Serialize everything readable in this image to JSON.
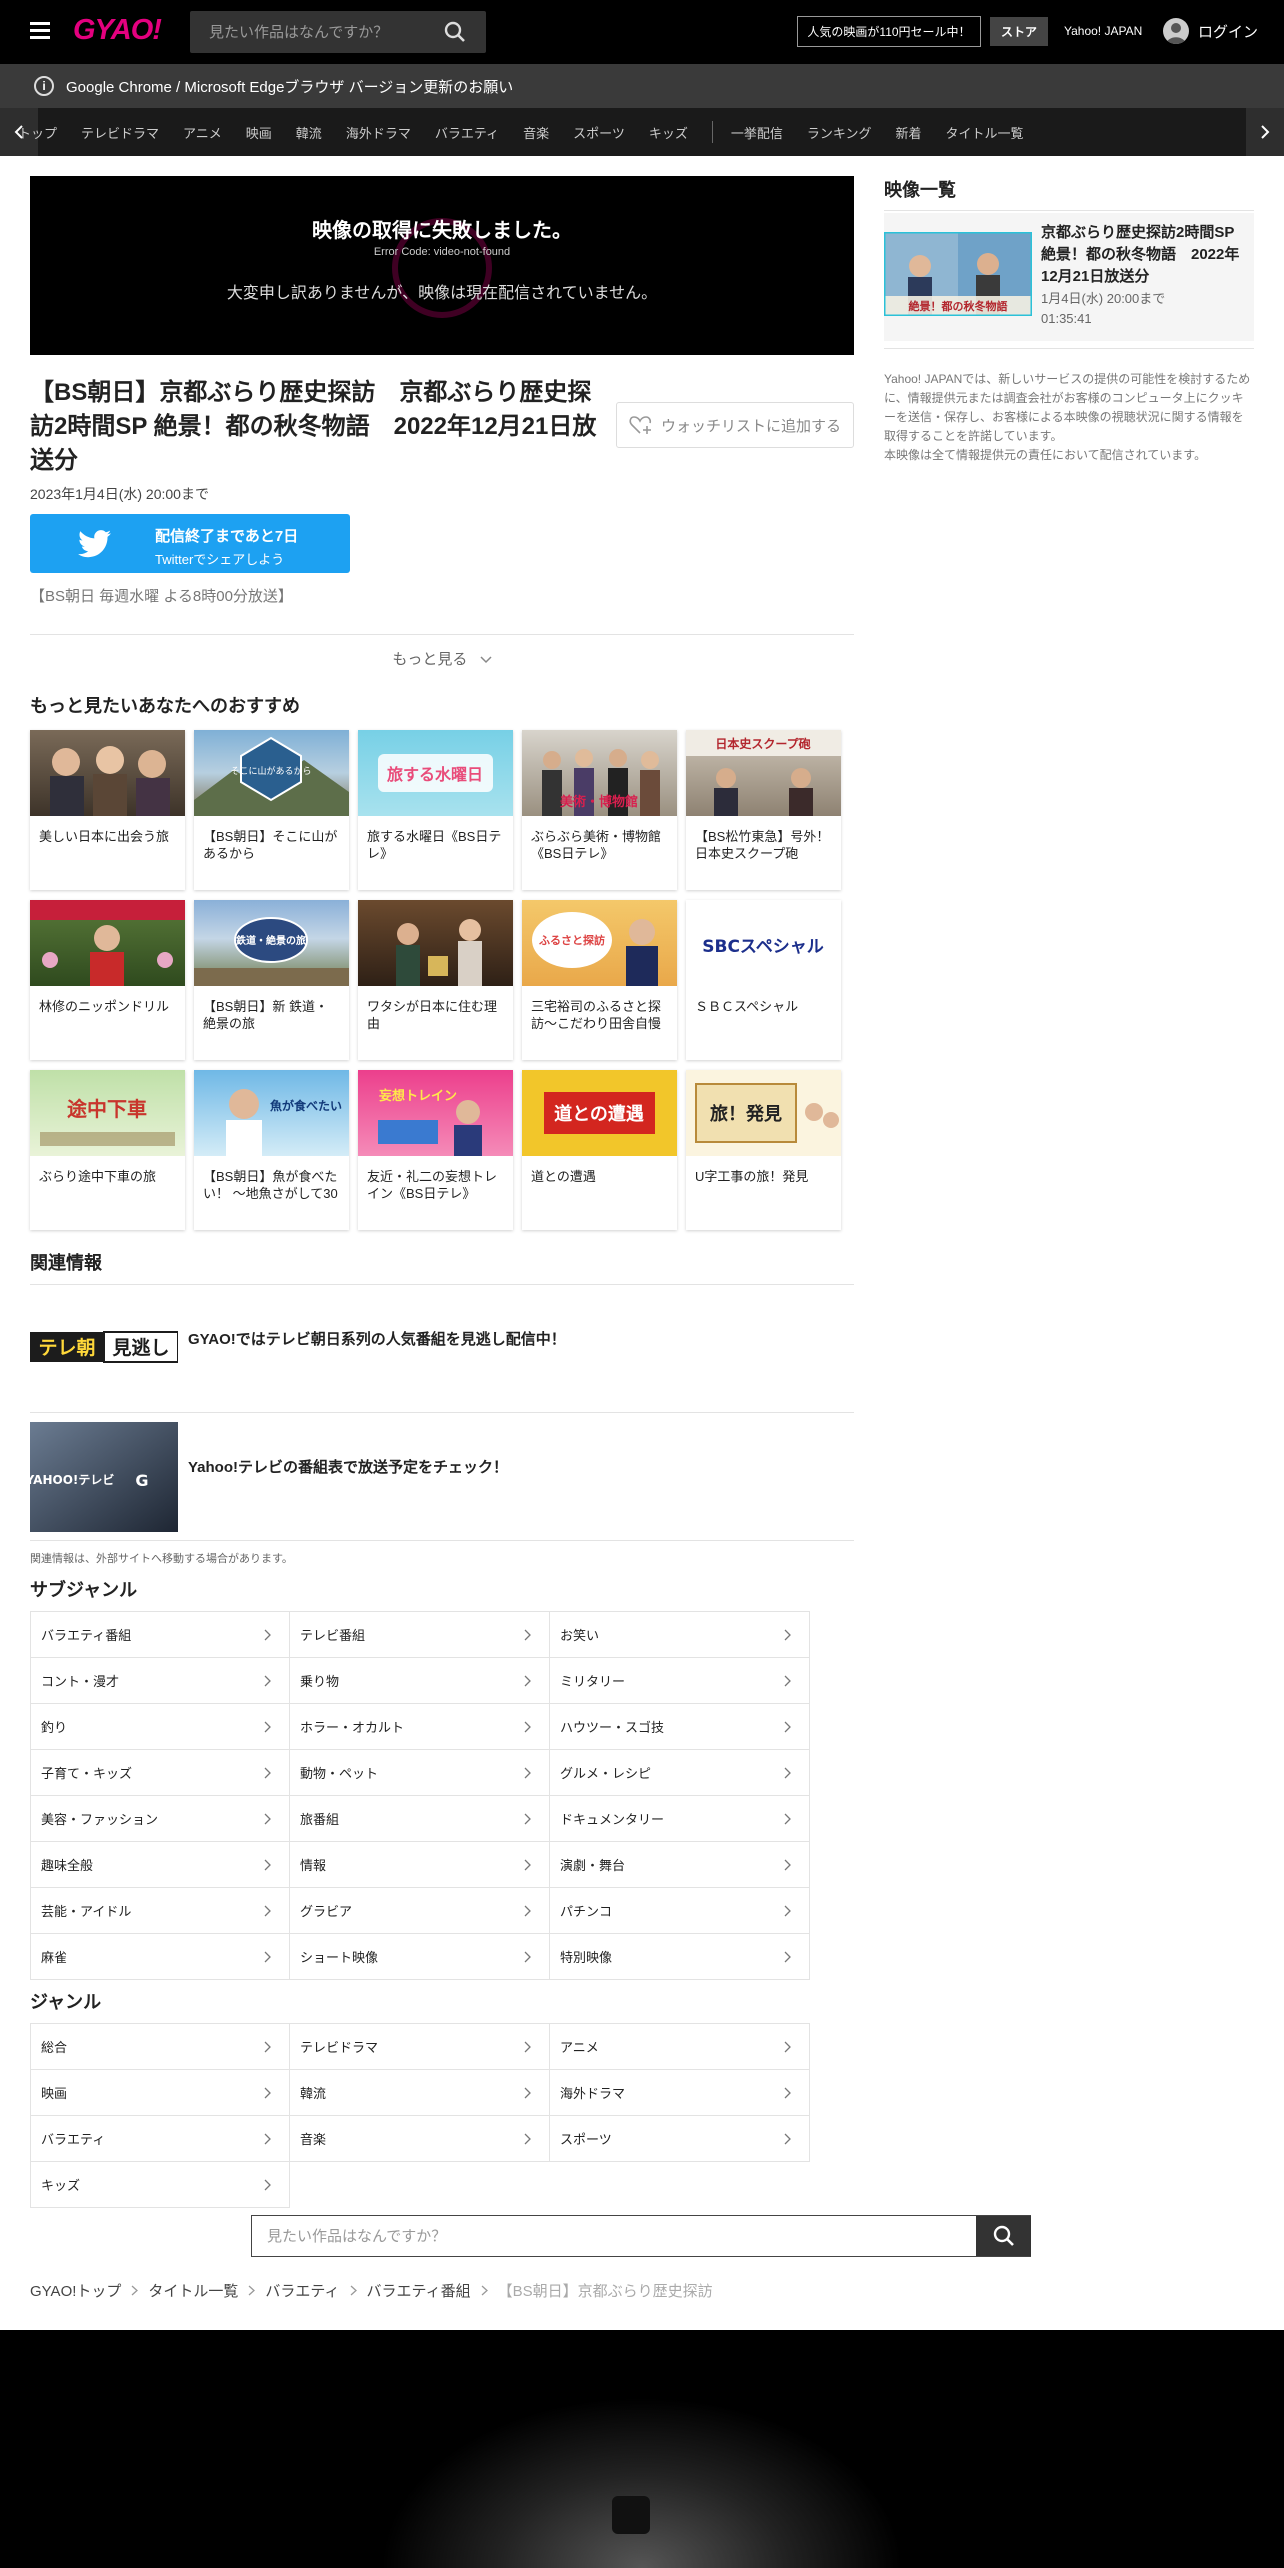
{
  "header": {
    "logo": "GYAO!",
    "search_placeholder": "見たい作品はなんですか？",
    "sale_label": "人気の映画が110円セール中！",
    "store_label": "ストア",
    "yahoo_label": "Yahoo! JAPAN",
    "login_label": "ログイン"
  },
  "banner": {
    "text": "Google Chrome / Microsoft Edgeブラウザ バージョン更新のお願い"
  },
  "nav": {
    "items": [
      "トップ",
      "テレビドラマ",
      "アニメ",
      "映画",
      "韓流",
      "海外ドラマ",
      "バラエティ",
      "音楽",
      "スポーツ",
      "キッズ"
    ],
    "items2": [
      "一挙配信",
      "ランキング",
      "新着",
      "タイトル一覧"
    ]
  },
  "player": {
    "error_title": "映像の取得に失敗しました。",
    "error_code": "Error Code: video-not-found",
    "error_message": "大変申し訳ありませんが、映像は現在配信されていません。"
  },
  "episode": {
    "title": "【BS朝日】京都ぶらり歴史探訪　京都ぶらり歴史探訪2時間SP 絶景！都の秋冬物語　2022年12月21日放送分",
    "watchlist_label": "ウォッチリストに追加する",
    "available_until": "2023年1月4日(水) 20:00まで",
    "twitter_line1": "配信終了まであと7日",
    "twitter_line2": "Twitterでシェアしよう",
    "broadcast_note": "【BS朝日 毎週水曜 よる8時00分放送】",
    "more_label": "もっと見る"
  },
  "recommend": {
    "heading": "もっと見たいあなたへのおすすめ",
    "items": [
      {
        "title": "美しい日本に出会う旅"
      },
      {
        "title": "【BS朝日】そこに山があるから"
      },
      {
        "title": "旅する水曜日《BS日テレ》"
      },
      {
        "title": "ぶらぶら美術・博物館《BS日テレ》"
      },
      {
        "title": "【BS松竹東急】号外！日本史スクープ砲"
      },
      {
        "title": "林修のニッポンドリル"
      },
      {
        "title": "【BS朝日】新 鉄道・絶景の旅"
      },
      {
        "title": "ワタシが日本に住む理由"
      },
      {
        "title": "三宅裕司のふるさと探訪～こだわり田舎自慢"
      },
      {
        "title": "ＳＢＣスペシャル"
      },
      {
        "title": "ぶらり途中下車の旅"
      },
      {
        "title": "【BS朝日】魚が食べたい！ ～地魚さがして30"
      },
      {
        "title": "友近・礼二の妄想トレイン《BS日テレ》"
      },
      {
        "title": "道との遭遇"
      },
      {
        "title": "U字工事の旅！発見"
      }
    ],
    "thumb_texts": {
      "t2": "そこに山があるから",
      "t3": "旅する水曜日",
      "t4": "美術・博物館",
      "t5": "日本史スクープ砲",
      "t7": "鉄道・絶景の旅",
      "t9": "ふるさと探訪",
      "t10": "SBCスペシャル",
      "t11": "途中下車",
      "t12": "魚が食べたい",
      "t13": "妄想トレイン",
      "t14": "道との遭遇",
      "t15": "旅！発見"
    }
  },
  "related": {
    "heading": "関連情報",
    "items": [
      {
        "logo": "テレ朝",
        "logo2": "見逃し",
        "text": "GYAO!ではテレビ朝日系列の人気番組を見逃し配信中！"
      },
      {
        "logo": "YAHOO!テレビ",
        "logo2": "G",
        "text": "Yahoo!テレビの番組表で放送予定をチェック！"
      }
    ],
    "note": "関連情報は、外部サイトへ移動する場合があります。"
  },
  "subgenre": {
    "heading": "サブジャンル",
    "items": [
      "バラエティ番組",
      "テレビ番組",
      "お笑い",
      "コント・漫才",
      "乗り物",
      "ミリタリー",
      "釣り",
      "ホラー・オカルト",
      "ハウツー・スゴ技",
      "子育て・キッズ",
      "動物・ペット",
      "グルメ・レシピ",
      "美容・ファッション",
      "旅番組",
      "ドキュメンタリー",
      "趣味全般",
      "情報",
      "演劇・舞台",
      "芸能・アイドル",
      "グラビア",
      "パチンコ",
      "麻雀",
      "ショート映像",
      "特別映像"
    ]
  },
  "genre": {
    "heading": "ジャンル",
    "items": [
      "総合",
      "テレビドラマ",
      "アニメ",
      "映画",
      "韓流",
      "海外ドラマ",
      "バラエティ",
      "音楽",
      "スポーツ",
      "キッズ"
    ]
  },
  "bottom_search": {
    "placeholder": "見たい作品はなんですか？"
  },
  "breadcrumb": [
    "GYAO!トップ",
    "タイトル一覧",
    "バラエティ",
    "バラエティ番組",
    "【BS朝日】京都ぶらり歴史探訪"
  ],
  "sidebar": {
    "heading": "映像一覧",
    "video": {
      "title": "京都ぶらり歴史探訪2時間SP 絶景！都の秋冬物語　2022年12月21日放送分",
      "until": "1月4日(水) 20:00まで",
      "duration": "01:35:41",
      "thumb_text": "絶景！都の秋冬物語"
    },
    "notice": "Yahoo! JAPANでは、新しいサービスの提供の可能性を検討するために、情報提供元または調査会社がお客様のコンピュータ上にクッキーを送信・保存し、お客様による本映像の視聴状況に関する情報を取得することを許諾しています。",
    "notice2": "本映像は全て情報提供元の責任において配信されています。"
  },
  "colors": {
    "brand": "#e4007f",
    "twitter": "#1da1f2",
    "header_bg": "#000000"
  }
}
